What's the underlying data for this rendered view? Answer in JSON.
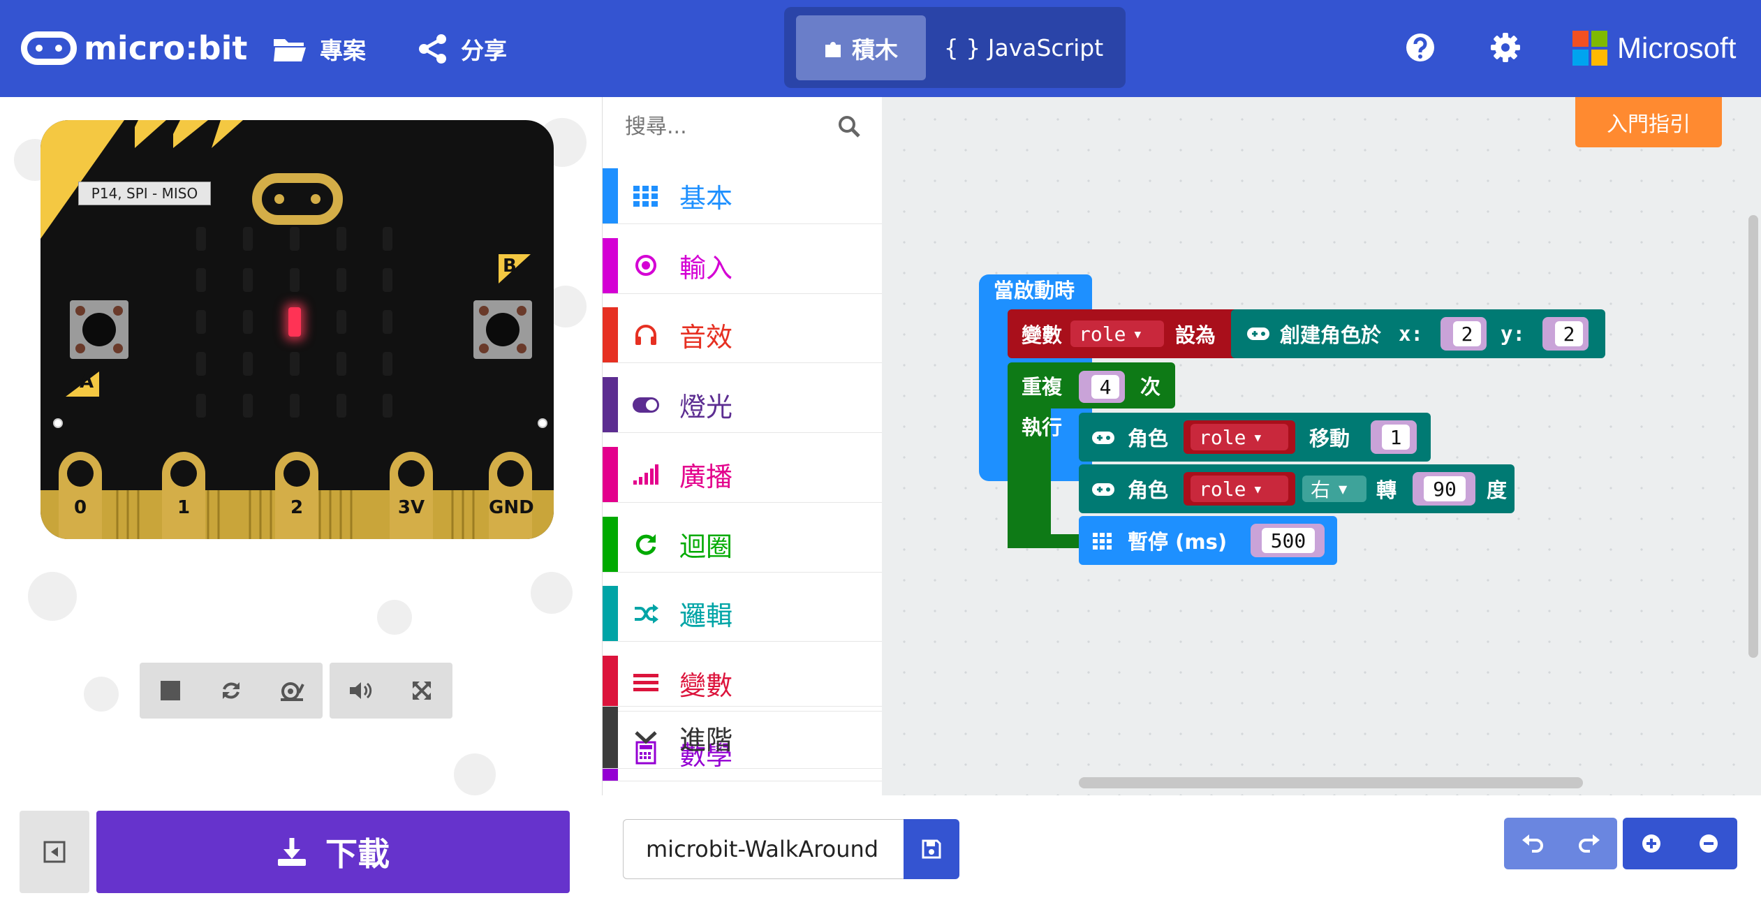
{
  "header": {
    "logo_text": "micro:bit",
    "projects_label": "專案",
    "share_label": "分享",
    "blocks_label": "積木",
    "javascript_label": "{ } JavaScript",
    "brand_text": "Microsoft",
    "colors": {
      "bar": "#3454D1",
      "toggle_bg": "#2A44A8",
      "toggle_active": "#6A7EC9"
    },
    "icons": [
      "folder-icon",
      "share-icon",
      "puzzle-icon",
      "help-icon",
      "gear-icon",
      "microsoft-logo"
    ]
  },
  "simulator": {
    "pin_tooltip": "P14, SPI - MISO",
    "button_a": "A",
    "button_b": "B",
    "pins": [
      "0",
      "1",
      "2",
      "3V",
      "GND"
    ],
    "controls": [
      "stop-icon",
      "restart-icon",
      "slow-motion-icon",
      "sound-icon",
      "fullscreen-icon"
    ],
    "lit_led": {
      "row": 2,
      "col": 2
    }
  },
  "toolbox": {
    "search_placeholder": "搜尋...",
    "categories": [
      {
        "label": "基本",
        "color": "#1E90FF",
        "icon": "grid-icon"
      },
      {
        "label": "輸入",
        "color": "#D400D4",
        "icon": "radio-target-icon"
      },
      {
        "label": "音效",
        "color": "#E63022",
        "icon": "headphones-icon"
      },
      {
        "label": "燈光",
        "color": "#5C2D91",
        "icon": "toggle-icon"
      },
      {
        "label": "廣播",
        "color": "#E3008C",
        "icon": "signal-bars-icon"
      },
      {
        "label": "迴圈",
        "color": "#00AA00",
        "icon": "refresh-icon"
      },
      {
        "label": "邏輯",
        "color": "#00A4A6",
        "icon": "shuffle-icon"
      },
      {
        "label": "變數",
        "color": "#DC143C",
        "icon": "lines-icon"
      },
      {
        "label": "數學",
        "color": "#9400D3",
        "icon": "calculator-icon"
      }
    ],
    "advanced": {
      "label": "進階",
      "color": "#3C3C3C",
      "icon": "chevron-down-icon"
    }
  },
  "workspace": {
    "guide_label": "入門指引",
    "colors": {
      "event": "#1E90FF",
      "variables": "#DC143C",
      "game": "#007A4B",
      "loops": "#00AA00",
      "basic": "#1E90FF"
    },
    "blocks": {
      "on_start": "當啟動時",
      "set_prefix": "變數",
      "set_var": "role",
      "set_suffix": "設為",
      "create_sprite": "創建角色於",
      "x_label": "x:",
      "x_value": "2",
      "y_label": "y:",
      "y_value": "2",
      "repeat_label": "重複",
      "repeat_count": "4",
      "repeat_times": "次",
      "do_label": "執行",
      "sprite_label_1": "角色",
      "move_var": "role",
      "move_label": "移動",
      "move_value": "1",
      "sprite_label_2": "角色",
      "turn_var": "role",
      "turn_dir": "右",
      "turn_label": "轉",
      "turn_value": "90",
      "turn_unit": "度",
      "pause_label": "暫停 (ms)",
      "pause_value": "500"
    }
  },
  "footer": {
    "download_label": "下載",
    "project_name": "microbit-WalkAround",
    "colors": {
      "download": "#6633CC",
      "tool": "#3454D1"
    },
    "icons": [
      "collapse-icon",
      "download-icon",
      "save-icon",
      "undo-icon",
      "redo-icon",
      "zoom-in-icon",
      "zoom-out-icon"
    ]
  }
}
